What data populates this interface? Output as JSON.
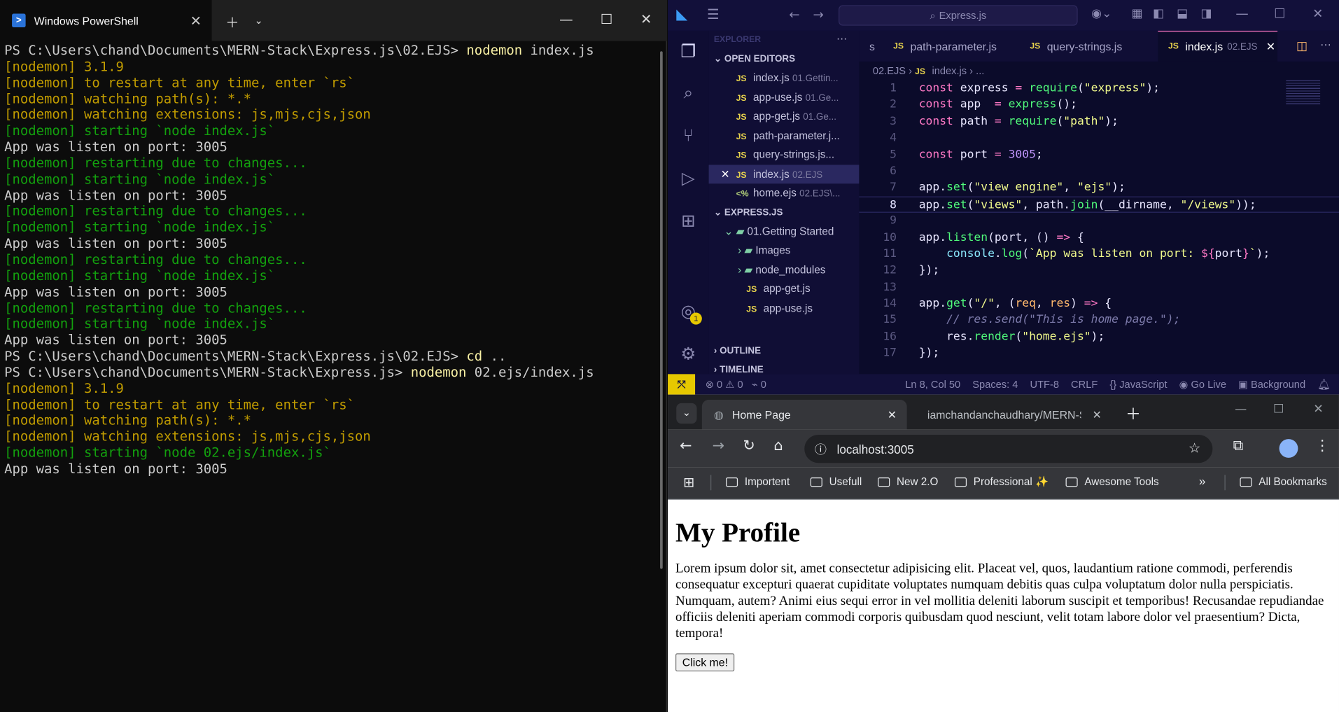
{
  "powershell": {
    "tab_title": "Windows PowerShell",
    "lines": [
      {
        "t": "PS C:\\Users\\chand\\Documents\\MERN-Stack\\Express.js\\02.EJS> ",
        "c": "c-white",
        "cmd": "nodemon",
        "arg": " index.js"
      },
      {
        "t": "[nodemon] 3.1.9",
        "c": "c-yellow"
      },
      {
        "t": "[nodemon] to restart at any time, enter `rs`",
        "c": "c-yellow"
      },
      {
        "t": "[nodemon] watching path(s): *.*",
        "c": "c-yellow"
      },
      {
        "t": "[nodemon] watching extensions: js,mjs,cjs,json",
        "c": "c-yellow"
      },
      {
        "t": "[nodemon] starting `node index.js`",
        "c": "c-green"
      },
      {
        "t": "App was listen on port: 3005",
        "c": "c-white"
      },
      {
        "t": "[nodemon] restarting due to changes...",
        "c": "c-green"
      },
      {
        "t": "[nodemon] starting `node index.js`",
        "c": "c-green"
      },
      {
        "t": "App was listen on port: 3005",
        "c": "c-white"
      },
      {
        "t": "[nodemon] restarting due to changes...",
        "c": "c-green"
      },
      {
        "t": "[nodemon] starting `node index.js`",
        "c": "c-green"
      },
      {
        "t": "App was listen on port: 3005",
        "c": "c-white"
      },
      {
        "t": "[nodemon] restarting due to changes...",
        "c": "c-green"
      },
      {
        "t": "[nodemon] starting `node index.js`",
        "c": "c-green"
      },
      {
        "t": "App was listen on port: 3005",
        "c": "c-white"
      },
      {
        "t": "[nodemon] restarting due to changes...",
        "c": "c-green"
      },
      {
        "t": "[nodemon] starting `node index.js`",
        "c": "c-green"
      },
      {
        "t": "App was listen on port: 3005",
        "c": "c-white"
      },
      {
        "t": "PS C:\\Users\\chand\\Documents\\MERN-Stack\\Express.js\\02.EJS> ",
        "c": "c-white",
        "cmd": "cd",
        "arg": " .."
      },
      {
        "t": "PS C:\\Users\\chand\\Documents\\MERN-Stack\\Express.js> ",
        "c": "c-white",
        "cmd": "nodemon",
        "arg": " 02.ejs/index.js"
      },
      {
        "t": "[nodemon] 3.1.9",
        "c": "c-yellow"
      },
      {
        "t": "[nodemon] to restart at any time, enter `rs`",
        "c": "c-yellow"
      },
      {
        "t": "[nodemon] watching path(s): *.*",
        "c": "c-yellow"
      },
      {
        "t": "[nodemon] watching extensions: js,mjs,cjs,json",
        "c": "c-yellow"
      },
      {
        "t": "[nodemon] starting `node 02.ejs/index.js`",
        "c": "c-green"
      },
      {
        "t": "App was listen on port: 3005",
        "c": "c-white"
      }
    ]
  },
  "vscode": {
    "search": "Express.js",
    "explorer_label": "EXPLORER",
    "open_editors_label": "OPEN EDITORS",
    "open_editors": [
      {
        "name": "index.js",
        "dir": "01.Gettin..."
      },
      {
        "name": "app-use.js",
        "dir": "01.Ge..."
      },
      {
        "name": "app-get.js",
        "dir": "01.Ge..."
      },
      {
        "name": "path-parameter.j...",
        "dir": ""
      },
      {
        "name": "query-strings.js...",
        "dir": ""
      },
      {
        "name": "index.js",
        "dir": "02.EJS"
      },
      {
        "name": "home.ejs",
        "dir": "02.EJS\\..."
      }
    ],
    "project_label": "EXPRESS.JS",
    "tree": [
      {
        "name": "01.Getting Started"
      },
      {
        "name": "Images"
      },
      {
        "name": "node_modules"
      },
      {
        "name": "app-get.js"
      },
      {
        "name": "app-use.js"
      }
    ],
    "outline_label": "OUTLINE",
    "timeline_label": "TIMELINE",
    "tabs": [
      {
        "label": "s"
      },
      {
        "label": "path-parameter.js"
      },
      {
        "label": "query-strings.js"
      },
      {
        "label": "index.js",
        "dir": "02.EJS"
      }
    ],
    "breadcrumb": {
      "folder": "02.EJS",
      "file": "index.js",
      "rest": "..."
    },
    "code_lines": [
      "1",
      "2",
      "3",
      "4",
      "5",
      "6",
      "7",
      "8",
      "9",
      "10",
      "11",
      "12",
      "13",
      "14",
      "15",
      "16",
      "17"
    ],
    "status": {
      "errors": "0",
      "warnings": "0",
      "ports": "0",
      "position": "Ln 8, Col 50",
      "spaces": "Spaces: 4",
      "encoding": "UTF-8",
      "eol": "CRLF",
      "language": "JavaScript",
      "golive": "Go Live",
      "background": "Background"
    },
    "accounts_badge": "1"
  },
  "chrome": {
    "tab1": "Home Page",
    "tab2": "iamchandanchaudhary/MERN-S",
    "url": "localhost:3005",
    "bookmarks": [
      "Importent",
      "Usefull",
      "New 2.O",
      "Professional ✨",
      "Awesome Tools"
    ],
    "all_bookmarks": "All Bookmarks",
    "page": {
      "heading": "My Profile",
      "paragraph": "Lorem ipsum dolor sit, amet consectetur adipisicing elit. Placeat vel, quos, laudantium ratione commodi, perferendis consequatur excepturi quaerat cupiditate voluptates numquam debitis quas culpa voluptatum dolor nulla perspiciatis. Numquam, autem? Animi eius sequi error in vel mollitia deleniti laborum suscipit et temporibus! Recusandae repudiandae officiis deleniti aperiam commodi corporis quibusdam quod nesciunt, velit totam labore dolor vel praesentium? Dicta, tempora!",
      "button": "Click me!"
    }
  },
  "colors": {
    "vscode_bg": "#0b0b2a",
    "nodemon_yellow": "#c19c00",
    "nodemon_green": "#13a10e",
    "remote_yellow": "#e6c800"
  }
}
